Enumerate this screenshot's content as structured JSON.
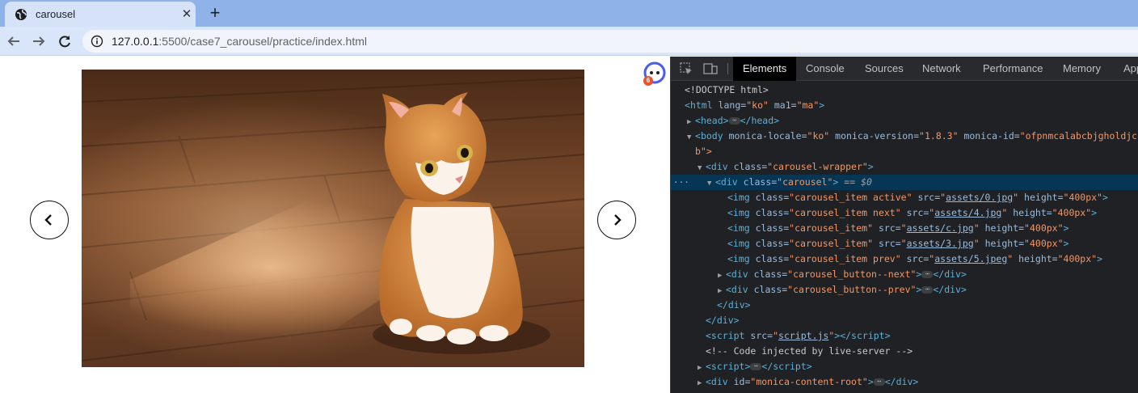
{
  "browser": {
    "tab_title": "carousel",
    "tab_close": "✕",
    "new_tab": "+",
    "url_host": "127.0.0.1",
    "url_rest": ":5500/case7_carousel/practice/index.html"
  },
  "page": {
    "image_alt": "orange and white cat sitting on wooden floor",
    "prev_glyph": "‹",
    "next_glyph": "›",
    "monica_badge": "6"
  },
  "devtools": {
    "tabs": [
      "Elements",
      "Console",
      "Sources",
      "Network",
      "Performance",
      "Memory",
      "App"
    ],
    "active_tab": "Elements",
    "selected_marker": "== $0",
    "lines": {
      "doctype": "<!DOCTYPE html>",
      "html_open": "html",
      "html_lang_attr": "lang",
      "html_lang_val": "\"ko\"",
      "html_ma1_attr": "ma1",
      "html_ma1_val": "\"ma\"",
      "head": "head",
      "body": "body",
      "body_locale_attr": "monica-locale",
      "body_locale_val": "\"ko\"",
      "body_version_attr": "monica-version",
      "body_version_val": "\"1.8.3\"",
      "body_id_attr": "monica-id",
      "body_id_val": "\"ofpnmcalabcbjgholdjcjblkibolbppb\"",
      "body_wrap": "b\">",
      "wrapper_class": "\"carousel-wrapper\"",
      "carousel_class": "\"carousel\"",
      "img_items": [
        {
          "cls": "\"carousel_item active\"",
          "src": "assets/0.jpg",
          "height": "\"400px\""
        },
        {
          "cls": "\"carousel_item next\"",
          "src": "assets/4.jpg",
          "height": "\"400px\""
        },
        {
          "cls": "\"carousel_item\"",
          "src": "assets/c.jpg",
          "height": "\"400px\""
        },
        {
          "cls": "\"carousel_item\"",
          "src": "assets/3.jpg",
          "height": "\"400px\""
        },
        {
          "cls": "\"carousel_item prev\"",
          "src": "assets/5.jpeg",
          "height": "\"400px\""
        }
      ],
      "btn_next_class": "\"carousel_button--next\"",
      "btn_prev_class": "\"carousel_button--prev\"",
      "script_src": "script.js",
      "comment": "<!-- Code injected by live-server -->",
      "root_id": "\"monica-content-root\""
    }
  },
  "colors": {
    "tabstrip": "#8fb3e9",
    "devtools_bg": "#202124",
    "selected_row": "#073655",
    "tag": "#5db0d7",
    "attr_value": "#f29766"
  }
}
